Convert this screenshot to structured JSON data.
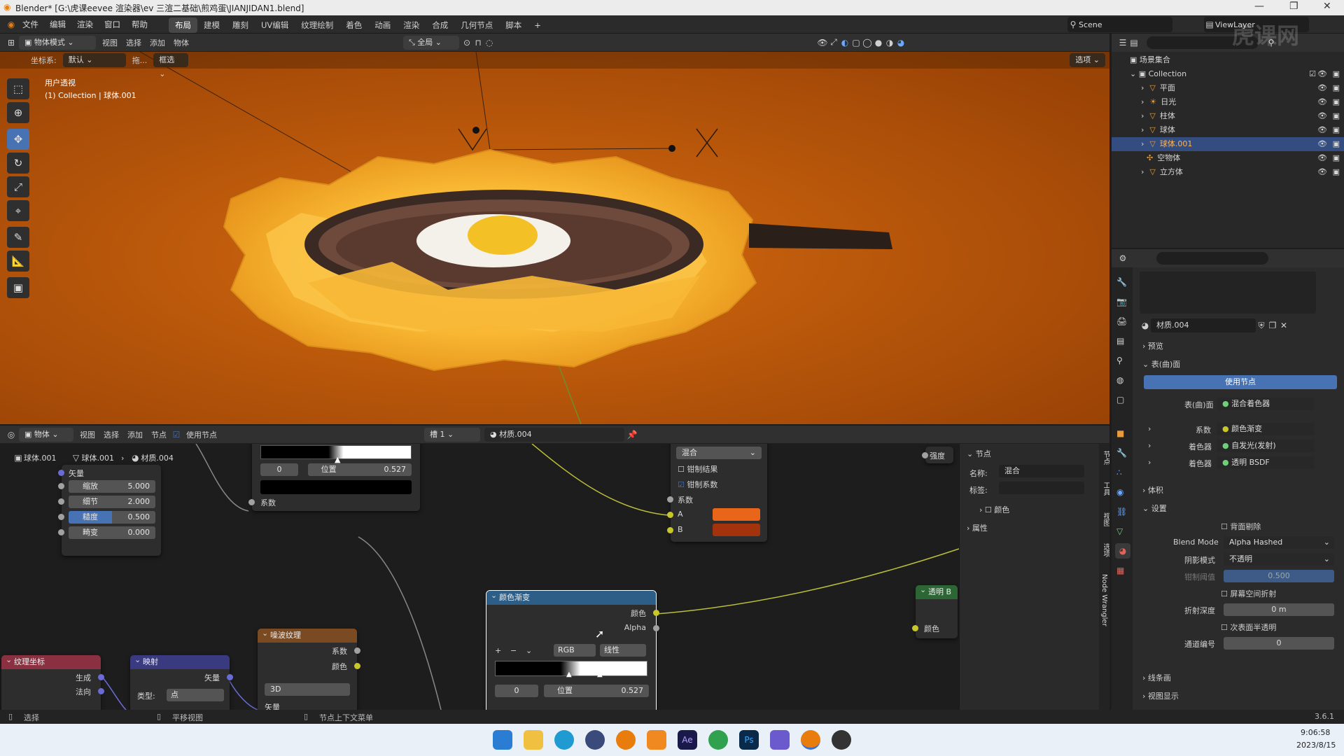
{
  "titlebar": {
    "title": "Blender* [G:\\虎课eevee 渲染器\\ev 三渲二基础\\煎鸡蛋\\JIANJIDAN1.blend]"
  },
  "menu": {
    "items": [
      "文件",
      "编辑",
      "渲染",
      "窗口",
      "帮助"
    ]
  },
  "workspaces": [
    "布局",
    "建模",
    "雕刻",
    "UV编辑",
    "纹理绘制",
    "着色",
    "动画",
    "渲染",
    "合成",
    "几何节点",
    "脚本"
  ],
  "active_workspace": "布局",
  "scene": {
    "scene_name": "Scene",
    "view_layer": "ViewLayer"
  },
  "viewport_header": {
    "mode": "物体模式",
    "menus": [
      "视图",
      "选择",
      "添加",
      "物体"
    ],
    "transform": "全局",
    "coord_label": "坐标系:",
    "coord_value": "默认",
    "drag_label": "拖...",
    "select_value": "框选",
    "options": "选项"
  },
  "viewport": {
    "view_name": "用户透视",
    "collection_text": "(1) Collection | 球体.001"
  },
  "outliner": {
    "root": "场景集合",
    "collection": "Collection",
    "items": [
      {
        "name": "平面",
        "selected": false
      },
      {
        "name": "日光",
        "selected": false
      },
      {
        "name": "柱体",
        "selected": false
      },
      {
        "name": "球体",
        "selected": false
      },
      {
        "name": "球体.001",
        "selected": true
      },
      {
        "name": "空物体",
        "selected": false
      },
      {
        "name": "立方体",
        "selected": false
      }
    ]
  },
  "node_header": {
    "object_mode": "物体",
    "menus": [
      "视图",
      "选择",
      "添加",
      "节点"
    ],
    "use_nodes_label": "使用节点",
    "slot": "槽 1",
    "material": "材质.004"
  },
  "breadcrumb": {
    "object": "球体.001",
    "mesh": "球体.001",
    "material": "材质.004"
  },
  "nodes": {
    "mapping_partial": {
      "vector_label": "矢量",
      "fields": [
        {
          "label": "缩放",
          "value": "5.000"
        },
        {
          "label": "细节",
          "value": "2.000"
        },
        {
          "label": "糙度",
          "value": "0.500"
        },
        {
          "label": "畸变",
          "value": "0.000"
        }
      ]
    },
    "ramp_top": {
      "stop_index": "0",
      "pos_label": "位置",
      "pos_value": "0.527",
      "factor_label": "系数"
    },
    "mix": {
      "blend": "混合",
      "clamp_result": "钳制结果",
      "clamp_factor": "钳制系数",
      "factor": "系数",
      "a": "A",
      "b": "B",
      "a_color": "#e8651a",
      "b_color": "#a3330c"
    },
    "color_ramp": {
      "title": "颜色渐变",
      "out_color": "颜色",
      "out_alpha": "Alpha",
      "mode": "RGB",
      "interp": "线性",
      "stop_index": "0",
      "pos_label": "位置",
      "pos_value": "0.527"
    },
    "noise": {
      "title": "噪波纹理",
      "out_fac": "系数",
      "out_color": "颜色",
      "dim": "3D",
      "in_vector": "矢量"
    },
    "texcoord": {
      "title": "纹理坐标",
      "out_gen": "生成",
      "out_normal": "法向"
    },
    "mapping": {
      "title": "映射",
      "out_vector": "矢量",
      "type_label": "类型:",
      "type_value": "点"
    },
    "transparent": {
      "title": "透明 B",
      "out_color": "颜色"
    },
    "strength_label": "强度"
  },
  "node_sidebar": {
    "section": "节点",
    "name_label": "名称:",
    "name_value": "混合",
    "label_label": "标签:",
    "color_label": "颜色",
    "props_label": "属性",
    "tabs": [
      "节点",
      "工具",
      "视图",
      "选项",
      "Node Wrangler"
    ]
  },
  "properties": {
    "material": "材质.004",
    "preview": "预览",
    "surface": "表(曲)面",
    "use_nodes": "使用节点",
    "surface_label": "表(曲)面",
    "surface_value": "混合着色器",
    "rows": [
      {
        "label": "系数",
        "value": "颜色渐变"
      },
      {
        "label": "着色器",
        "value": "自发光(发射)"
      },
      {
        "label": "着色器",
        "value": "透明 BSDF"
      }
    ],
    "volume": "体积",
    "settings": "设置",
    "backface": "背面剔除",
    "blend_mode_label": "Blend Mode",
    "blend_mode_value": "Alpha Hashed",
    "shadow_label": "阴影模式",
    "shadow_value": "不透明",
    "clip_label": "钳制阈值",
    "clip_value": "0.500",
    "ssr": "屏幕空间折射",
    "refr_label": "折射深度",
    "refr_value": "0 m",
    "sss": "次表面半透明",
    "pass_label": "通道编号",
    "pass_value": "0",
    "lineart": "线条画",
    "viewport_display": "视图显示"
  },
  "statusbar": {
    "select": "选择",
    "pan": "平移视图",
    "context": "节点上下文菜单",
    "version": "3.6.1"
  },
  "taskbar": {
    "time": "9:06:58",
    "date": "2023/8/15"
  },
  "watermark": "虎课网"
}
